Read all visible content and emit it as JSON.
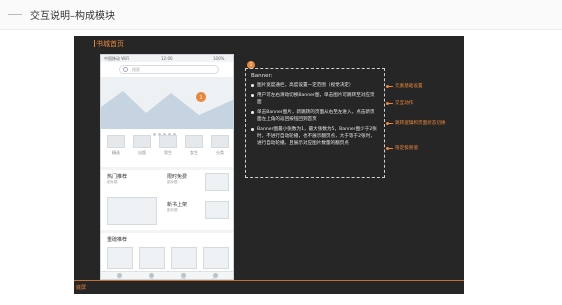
{
  "header": {
    "title": "交互说明–构成模块"
  },
  "canvas": {
    "title": "书城首页",
    "bottom_label": "底屏"
  },
  "phone": {
    "status": {
      "carrier": "中国移动 WiFi",
      "time": "12:00",
      "battery": "100%"
    },
    "search_placeholder": "搜索",
    "categories": [
      "精选",
      "出版",
      "男生",
      "女生",
      "分类"
    ],
    "hot": {
      "title": "热门推荐",
      "sub": "副标题"
    },
    "limited": {
      "title": "限时免费",
      "sub": "副标题"
    },
    "new": {
      "title": "新书上架",
      "sub": "副标题"
    },
    "featured": {
      "title": "重磅推荐"
    },
    "tabs": [
      "书城",
      "书架",
      "发现",
      "我的"
    ]
  },
  "annotation": {
    "marker": "1",
    "heading": "Banner:",
    "items": [
      "图片宽度通栏，高度设置一定范围（视觉决定）",
      "用户可左右滑动切换Banner图，单击图片可跳转至对应页面",
      "单击Banner图片，新跳转的页面从右至左进入，点击新页面左上角的返回按钮回到首页",
      "Banner图最小张数为1，最大张数为5，Banner图少于2张时，不进行自动轮播，也不展示翻页点，大于等于2张时，进行自动轮播，且展示对应图片数量的翻页点"
    ],
    "callouts": [
      "元素基础设置",
      "交互动作",
      "跳转逻辑和页面状态切换",
      "限定极限值"
    ]
  },
  "colors": {
    "accent": "#e8873a",
    "canvas_bg": "#262626"
  }
}
